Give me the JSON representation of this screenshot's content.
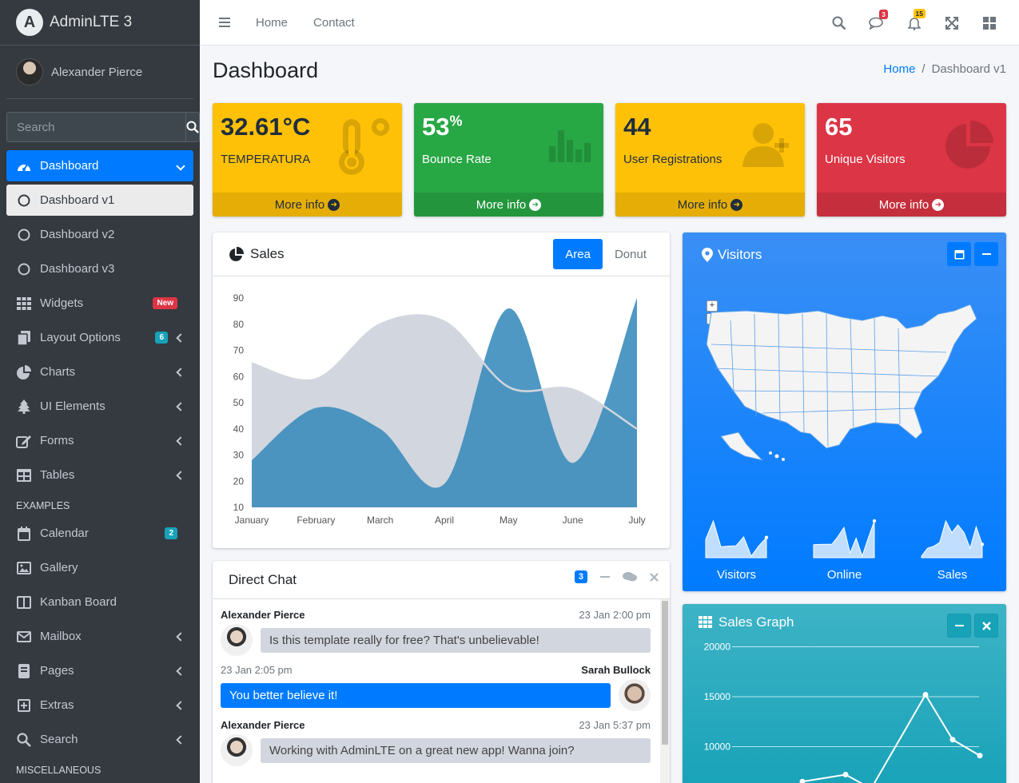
{
  "brand": {
    "name": "AdminLTE 3",
    "logo_letter": "A"
  },
  "user": {
    "name": "Alexander Pierce"
  },
  "sidebar": {
    "search_placeholder": "Search",
    "items": [
      {
        "label": "Dashboard",
        "icon": "tachometer-icon"
      },
      {
        "label": "Dashboard v1",
        "icon": "circle-icon"
      },
      {
        "label": "Dashboard v2",
        "icon": "circle-icon"
      },
      {
        "label": "Dashboard v3",
        "icon": "circle-icon"
      },
      {
        "label": "Widgets",
        "icon": "grid-icon",
        "badge": "New"
      },
      {
        "label": "Layout Options",
        "icon": "copy-icon",
        "badge": "6"
      },
      {
        "label": "Charts",
        "icon": "pie-chart-icon"
      },
      {
        "label": "UI Elements",
        "icon": "tree-icon"
      },
      {
        "label": "Forms",
        "icon": "edit-icon"
      },
      {
        "label": "Tables",
        "icon": "table-icon"
      }
    ],
    "examples_header": "EXAMPLES",
    "examples": [
      {
        "label": "Calendar",
        "icon": "calendar-icon",
        "badge": "2"
      },
      {
        "label": "Gallery",
        "icon": "image-icon"
      },
      {
        "label": "Kanban Board",
        "icon": "columns-icon"
      },
      {
        "label": "Mailbox",
        "icon": "envelope-icon"
      },
      {
        "label": "Pages",
        "icon": "book-icon"
      },
      {
        "label": "Extras",
        "icon": "plus-square-icon"
      },
      {
        "label": "Search",
        "icon": "search-icon"
      }
    ],
    "misc_header": "MISCELLANEOUS"
  },
  "topbar": {
    "links": [
      "Home",
      "Contact"
    ],
    "messages_badge": "3",
    "notifications_badge": "15"
  },
  "page": {
    "title": "Dashboard",
    "breadcrumb_home": "Home",
    "breadcrumb_current": "Dashboard v1"
  },
  "boxes": [
    {
      "value": "32.61°C",
      "label": "TEMPERATURA",
      "footer": "More info",
      "color": "#ffc107"
    },
    {
      "value": "53",
      "suffix": "%",
      "label": "Bounce Rate",
      "footer": "More info",
      "color": "#28a745"
    },
    {
      "value": "44",
      "label": "User Registrations",
      "footer": "More info",
      "color": "#ffc107"
    },
    {
      "value": "65",
      "label": "Unique Visitors",
      "footer": "More info",
      "color": "#dc3545"
    }
  ],
  "sales": {
    "title": "Sales",
    "tab_area": "Area",
    "tab_donut": "Donut"
  },
  "chart_data": {
    "type": "area",
    "title": "Sales",
    "categories": [
      "January",
      "February",
      "March",
      "April",
      "May",
      "June",
      "July"
    ],
    "ylim": [
      10,
      90
    ],
    "yticks": [
      10,
      20,
      30,
      40,
      50,
      60,
      70,
      80,
      90
    ],
    "series": [
      {
        "values": [
          28,
          48,
          40,
          19,
          86,
          27,
          90
        ],
        "color": "#3c8dbc"
      },
      {
        "values": [
          65,
          59,
          80,
          81,
          56,
          55,
          40
        ],
        "color": "#d2d6de"
      }
    ]
  },
  "chat": {
    "title": "Direct Chat",
    "badge": "3",
    "messages": [
      {
        "name": "Alexander Pierce",
        "time": "23 Jan 2:00 pm",
        "text": "Is this template really for free? That's unbelievable!",
        "side": "left"
      },
      {
        "name": "Sarah Bullock",
        "time": "23 Jan 2:05 pm",
        "text": "You better believe it!",
        "side": "right"
      },
      {
        "name": "Alexander Pierce",
        "time": "23 Jan 5:37 pm",
        "text": "Working with AdminLTE on a great new app! Wanna join?",
        "side": "left"
      }
    ]
  },
  "visitors": {
    "title": "Visitors",
    "sparklines": [
      {
        "label": "Visitors",
        "values": [
          1000,
          1200,
          920,
          927,
          931,
          1027,
          819,
          930,
          1021
        ]
      },
      {
        "label": "Online",
        "values": [
          515,
          519,
          520,
          522,
          652,
          810,
          370,
          627,
          319,
          630,
          921
        ]
      },
      {
        "label": "Sales",
        "values": [
          15,
          19,
          20,
          22,
          33,
          27,
          31,
          27,
          19,
          30,
          21
        ]
      }
    ]
  },
  "sales_graph": {
    "title": "Sales Graph",
    "yticks": [
      "20000",
      "15000",
      "10000"
    ],
    "chart_data": {
      "type": "line",
      "ylim": [
        5000,
        21000
      ],
      "values": [
        6500,
        7200,
        5800,
        15200,
        10700,
        9100
      ]
    }
  }
}
